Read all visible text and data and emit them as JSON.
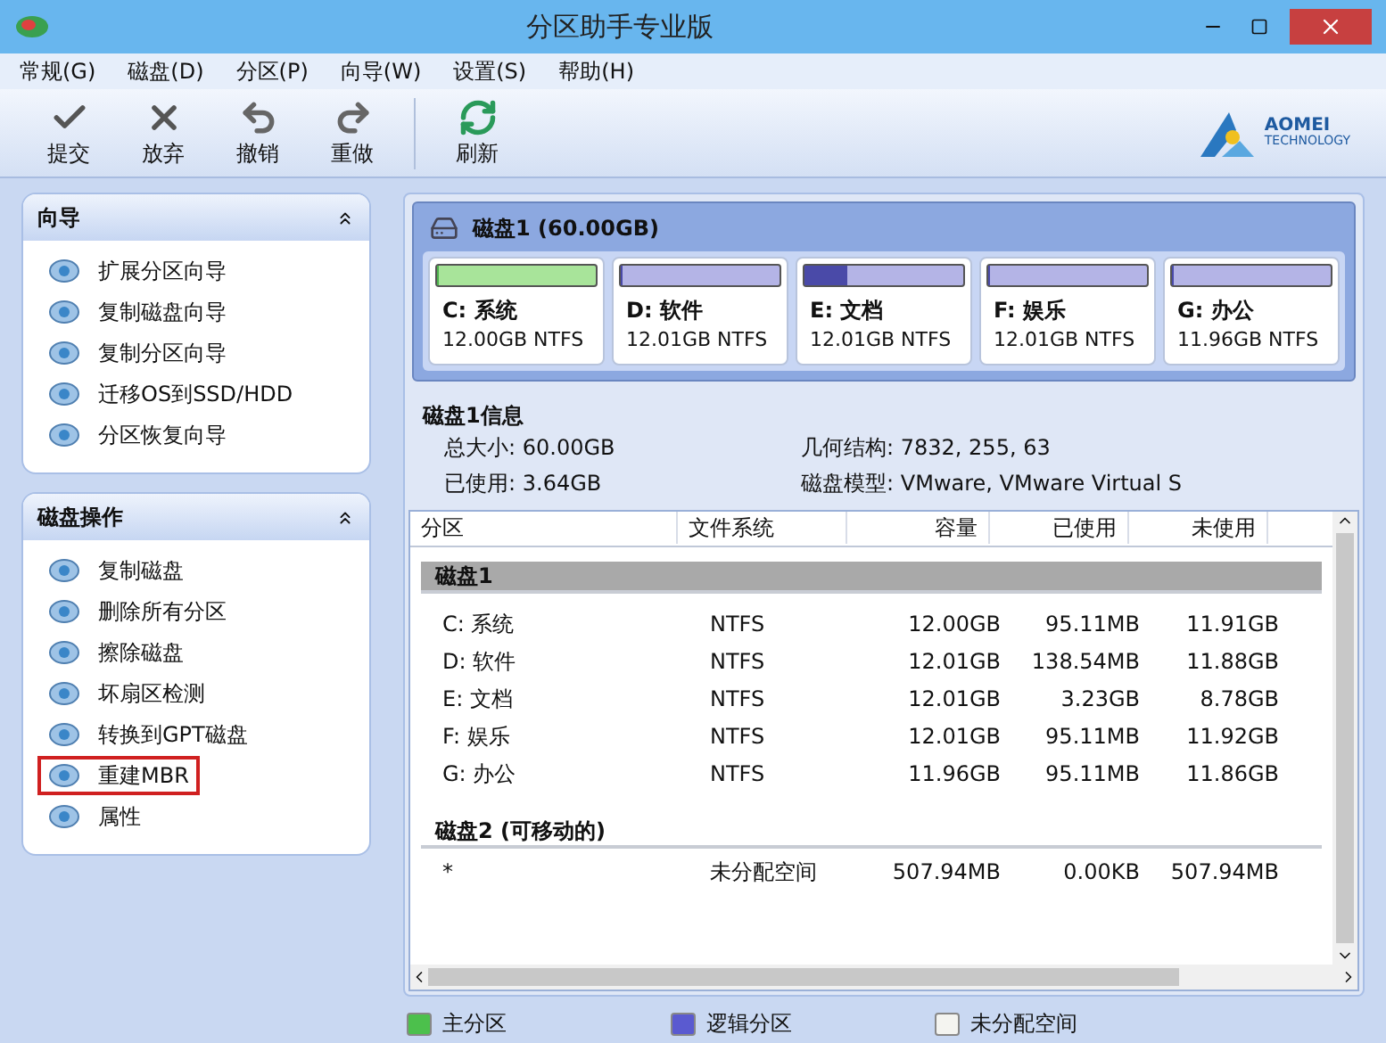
{
  "window": {
    "title": "分区助手专业版"
  },
  "menu": [
    "常规(G)",
    "磁盘(D)",
    "分区(P)",
    "向导(W)",
    "设置(S)",
    "帮助(H)"
  ],
  "toolbar": [
    {
      "kind": "check",
      "label": "提交"
    },
    {
      "kind": "discard",
      "label": "放弃"
    },
    {
      "kind": "undo",
      "label": "撤销"
    },
    {
      "kind": "redo",
      "label": "重做"
    },
    {
      "kind": "refresh",
      "label": "刷新"
    }
  ],
  "logo": {
    "name": "AOMEI",
    "sub": "TECHNOLOGY"
  },
  "sidebar": [
    {
      "title": "向导",
      "expanded": true,
      "items": [
        {
          "label": "扩展分区向导",
          "highlighted": false
        },
        {
          "label": "复制磁盘向导",
          "highlighted": false
        },
        {
          "label": "复制分区向导",
          "highlighted": false
        },
        {
          "label": "迁移OS到SSD/HDD",
          "highlighted": false
        },
        {
          "label": "分区恢复向导",
          "highlighted": false
        }
      ]
    },
    {
      "title": "磁盘操作",
      "expanded": true,
      "items": [
        {
          "label": "复制磁盘",
          "highlighted": false
        },
        {
          "label": "删除所有分区",
          "highlighted": false
        },
        {
          "label": "擦除磁盘",
          "highlighted": false
        },
        {
          "label": "坏扇区检测",
          "highlighted": false
        },
        {
          "label": "转换到GPT磁盘",
          "highlighted": false
        },
        {
          "label": "重建MBR",
          "highlighted": true
        },
        {
          "label": "属性",
          "highlighted": false
        }
      ]
    }
  ],
  "disk_map": {
    "title": "磁盘1 (60.00GB)",
    "partitions": [
      {
        "kind": "primary",
        "name": "C: 系统",
        "size": "12.00GB NTFS",
        "level": 0.01
      },
      {
        "kind": "logical",
        "name": "D: 软件",
        "size": "12.01GB NTFS",
        "level": 0.01
      },
      {
        "kind": "logical",
        "name": "E: 文档",
        "size": "12.01GB NTFS",
        "level": 0.27
      },
      {
        "kind": "logical",
        "name": "F: 娱乐",
        "size": "12.01GB NTFS",
        "level": 0.01
      },
      {
        "kind": "logical",
        "name": "G: 办公",
        "size": "11.96GB NTFS",
        "level": 0.01
      }
    ]
  },
  "disk_info": {
    "title": "磁盘1信息",
    "fields": [
      {
        "label": "总大小:",
        "value": "60.00GB"
      },
      {
        "label": "几何结构:",
        "value": "7832, 255, 63"
      },
      {
        "label": "已使用:",
        "value": "3.64GB"
      },
      {
        "label": "磁盘模型:",
        "value": "VMware, VMware Virtual S"
      }
    ]
  },
  "table": {
    "columns": [
      "分区",
      "文件系统",
      "容量",
      "已使用",
      "未使用"
    ],
    "groups": [
      {
        "title": "磁盘1",
        "selected": true,
        "rows": [
          [
            "C: 系统",
            "NTFS",
            "12.00GB",
            "95.11MB",
            "11.91GB"
          ],
          [
            "D: 软件",
            "NTFS",
            "12.01GB",
            "138.54MB",
            "11.88GB"
          ],
          [
            "E: 文档",
            "NTFS",
            "12.01GB",
            "3.23GB",
            "8.78GB"
          ],
          [
            "F: 娱乐",
            "NTFS",
            "12.01GB",
            "95.11MB",
            "11.92GB"
          ],
          [
            "G: 办公",
            "NTFS",
            "11.96GB",
            "95.11MB",
            "11.86GB"
          ]
        ]
      },
      {
        "title": "磁盘2 (可移动的)",
        "selected": false,
        "rows": [
          [
            "*",
            "未分配空间",
            "507.94MB",
            "0.00KB",
            "507.94MB"
          ]
        ]
      }
    ]
  },
  "legend": [
    {
      "label": "主分区",
      "color": "#4cc04c"
    },
    {
      "label": "逻辑分区",
      "color": "#5a5ad0"
    },
    {
      "label": "未分配空间",
      "color": "#f4f4f0"
    }
  ]
}
